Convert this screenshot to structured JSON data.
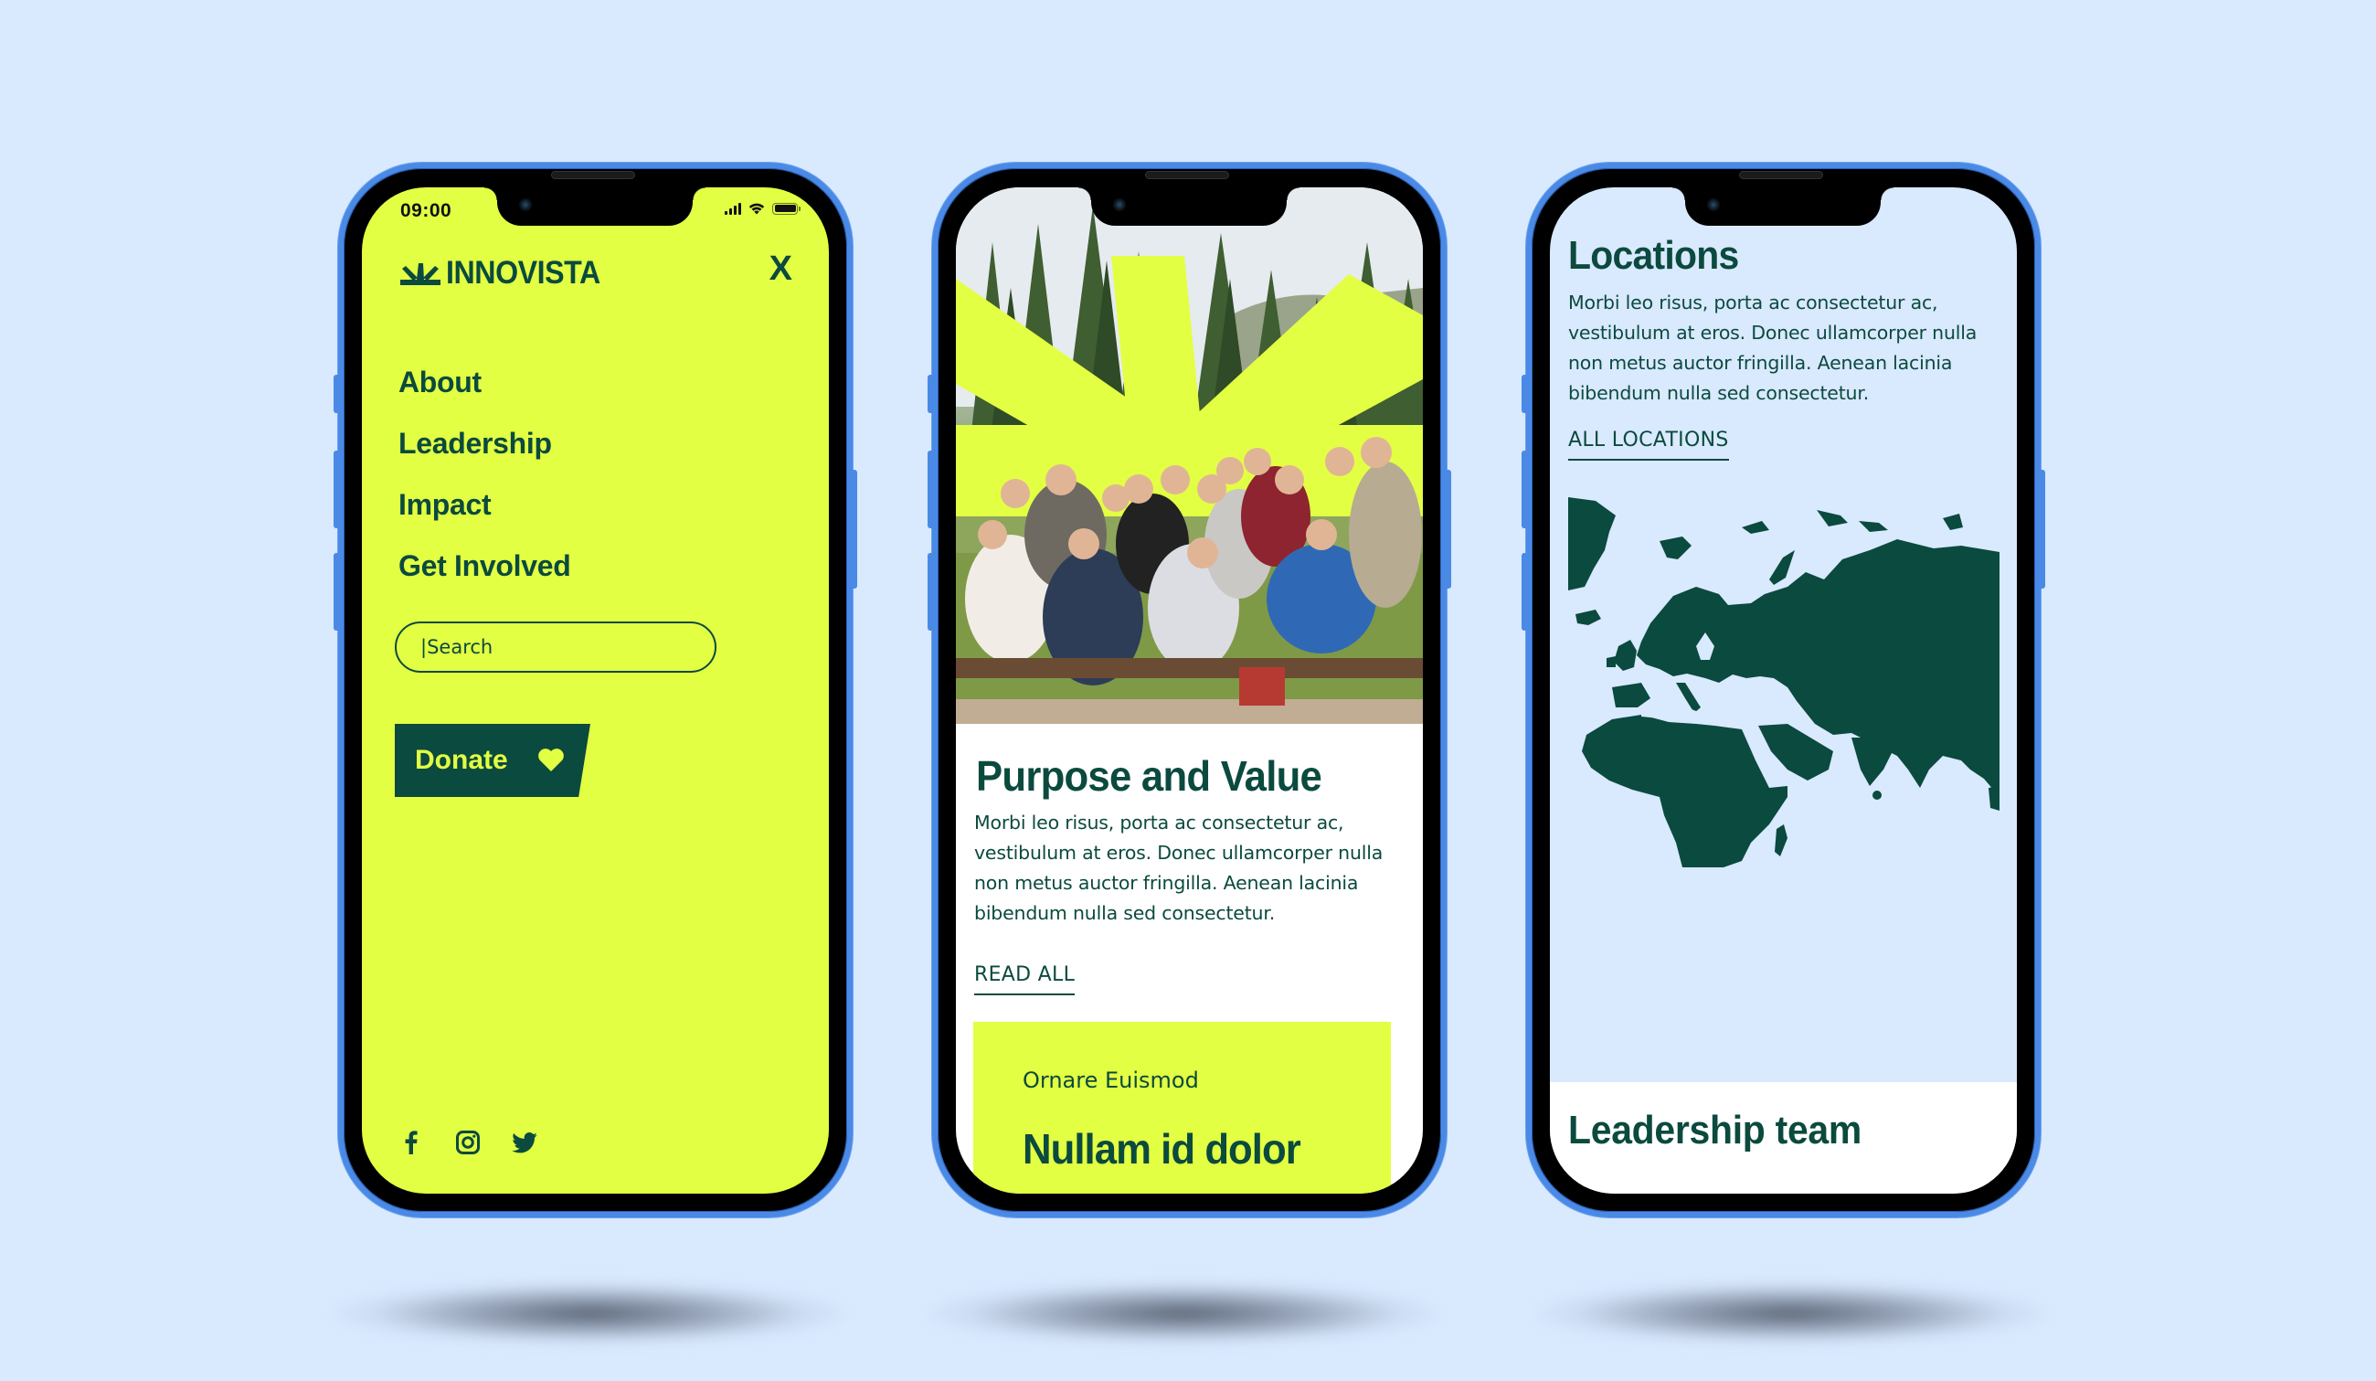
{
  "colors": {
    "background": "#d9e9fe",
    "brand_dark": "#0b4a3e",
    "brand_lime": "#e3ff43",
    "frame_blue": "#4a8ae6"
  },
  "phones": [
    {
      "screen": "navigation-menu",
      "status_bar": {
        "time": "09:00",
        "icons": [
          "cellular-signal-icon",
          "wifi-icon",
          "battery-icon"
        ]
      },
      "header": {
        "logo_text": "INNOVISTA",
        "logo_icon": "sunburst-logo-icon",
        "close_label": "X"
      },
      "menu": {
        "items": [
          {
            "label": "About"
          },
          {
            "label": "Leadership"
          },
          {
            "label": "Impact"
          },
          {
            "label": "Get Involved"
          }
        ]
      },
      "search": {
        "value": "",
        "placeholder": "|Search"
      },
      "donate": {
        "label": "Donate",
        "icon": "heart-icon"
      },
      "socials": [
        {
          "name": "facebook-icon"
        },
        {
          "name": "instagram-icon"
        },
        {
          "name": "twitter-icon"
        }
      ]
    },
    {
      "screen": "purpose",
      "hero": {
        "image_description": "group photo of young people outdoors in front of pine trees with lime sunburst graphic overlay"
      },
      "section": {
        "title": "Purpose and Value",
        "body": "Morbi leo risus, porta ac consectetur ac, vestibulum at eros. Donec ullamcorper nulla non metus auctor fringilla. Aenean lacinia bibendum nulla sed consectetur.",
        "link": "READ ALL"
      },
      "card": {
        "eyebrow": "Ornare Euismod",
        "title": "Nullam id dolor"
      }
    },
    {
      "screen": "locations",
      "section": {
        "title": "Locations",
        "body": "Morbi leo risus, porta ac consectetur ac, vestibulum at eros. Donec ullamcorper nulla non metus auctor fringilla. Aenean lacinia bibendum nulla sed consectetur.",
        "link": "ALL LOCATIONS"
      },
      "map": {
        "regions_shown": [
          "Europe",
          "Africa",
          "Asia",
          "Greenland"
        ]
      },
      "next_section": {
        "title": "Leadership team"
      }
    }
  ]
}
